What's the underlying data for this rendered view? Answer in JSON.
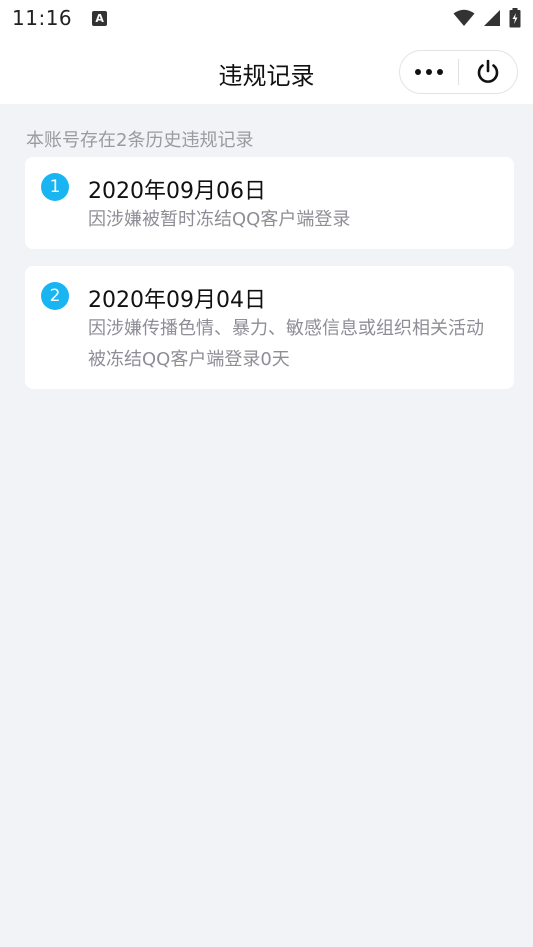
{
  "status_bar": {
    "time": "11:16",
    "notification_icon": "a-icon",
    "wifi_icon": "wifi-icon",
    "signal_icon": "signal-icon",
    "battery_icon": "battery-charging-icon"
  },
  "nav": {
    "title": "违规记录",
    "more_icon": "more-dots-icon",
    "close_icon": "power-icon"
  },
  "summary": "本账号存在2条历史违规记录",
  "records": [
    {
      "index": "1",
      "date": "2020年09月06日",
      "description": "因涉嫌被暂时冻结QQ客户端登录"
    },
    {
      "index": "2",
      "date": "2020年09月04日",
      "description": "因涉嫌传播色情、暴力、敏感信息或组织相关活动被冻结QQ客户端登录0天"
    }
  ],
  "colors": {
    "badge": "#19b5f2",
    "background": "#f2f3f7",
    "secondary_text": "#8e8e96"
  }
}
